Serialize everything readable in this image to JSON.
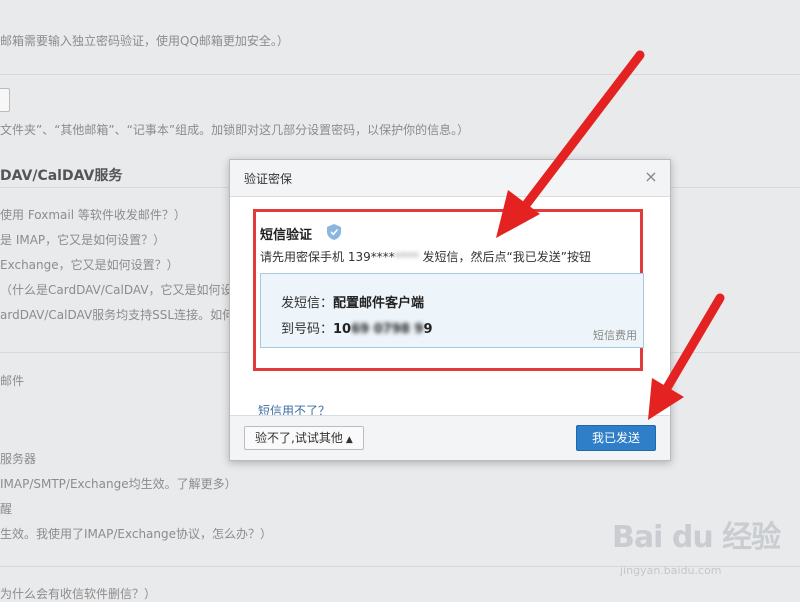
{
  "background": {
    "lines": [
      "邮箱需要输入独立密码验证，使用QQ邮箱更加安全。）",
      "文件夹”、“其他邮箱”、“记事本”组成。加锁即对这几部分设置密码，以保护你的信息。）",
      "使用 Foxmail 等软件收发邮件？）",
      "是 IMAP，它又是如何设置？）",
      "Exchange，它又是如何设置？）",
      "（什么是CardDAV/CalDAV，它又是如何设",
      "ardDAV/CalDAV服务均支持SSL连接。如何",
      "邮件",
      "服务器",
      "IMAP/SMTP/Exchange均生效。了解更多）",
      "醒",
      "生效。我使用了IMAP/Exchange协议，怎么办？）",
      "为什么会有收信软件删信？）"
    ],
    "heading": "DAV/CalDAV服务"
  },
  "dialog": {
    "title": "验证密保",
    "close": "×",
    "sms_title": "短信验证",
    "desc_prefix": "请先用密保手机 139****",
    "desc_masked": "****",
    "desc_suffix": " 发短信，然后点“我已发送”按钮",
    "send_label": "发短信：",
    "send_value": "配置邮件客户端",
    "to_label": "到号码：",
    "to_prefix": "10",
    "to_masked": "69 0798 9",
    "to_suffix": "9",
    "fee_link": "短信费用",
    "cant_use": "短信用不了？",
    "other_button": "验不了,试试其他",
    "sent_button": "我已发送"
  },
  "watermark": {
    "big": "Bai du 经验",
    "small": "jingyan.baidu.com"
  },
  "colors": {
    "highlight": "#e33b3b",
    "primary_button": "#2f7fc8",
    "info_box": "#eef5fa",
    "arrow": "#e52222"
  }
}
